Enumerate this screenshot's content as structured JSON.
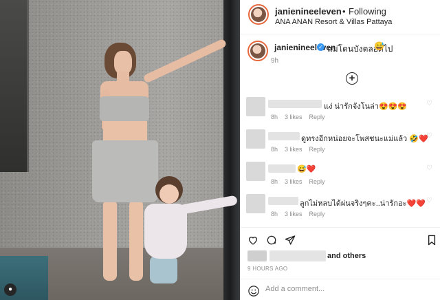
{
  "header": {
    "username": "janienineeleven",
    "separator": "•",
    "follow_label": "Following",
    "location": "ANA ANAN Resort & Villas Pattaya"
  },
  "caption": {
    "username": "janienineeleven",
    "verified_mark": "✓",
    "text": "แม่โดนบังตลอดไป",
    "emoji": "😅",
    "time": "9h"
  },
  "load_more_symbol": "+",
  "comments": [
    {
      "text": "แง่ น่ารักจังโนล่า😍😍😍",
      "time": "8h",
      "likes": "3 likes",
      "reply": "Reply"
    },
    {
      "text": "ดูทรงอีกหน่อยจะโพสชนะแม่แล้ว 🤣❤️",
      "time": "8h",
      "likes": "3 likes",
      "reply": "Reply"
    },
    {
      "text": "😅❤️",
      "time": "8h",
      "likes": "3 likes",
      "reply": "Reply"
    },
    {
      "text": "ลูกไม่หลบได้ผ่นจริงๆคะ..น่ารักอะ❤️❤️",
      "time": "8h",
      "likes": "3 likes",
      "reply": "Reply"
    }
  ],
  "actions": {
    "icons": [
      "heart-icon",
      "comment-icon",
      "share-icon",
      "bookmark-icon"
    ]
  },
  "likes": {
    "suffix": "and others"
  },
  "post_time": "9 HOURS AGO",
  "add_comment": {
    "placeholder": "Add a comment..."
  },
  "colors": {
    "verified": "#3897f0",
    "story_ring": "#e6683c",
    "meta_gray": "#8e8e8e"
  }
}
